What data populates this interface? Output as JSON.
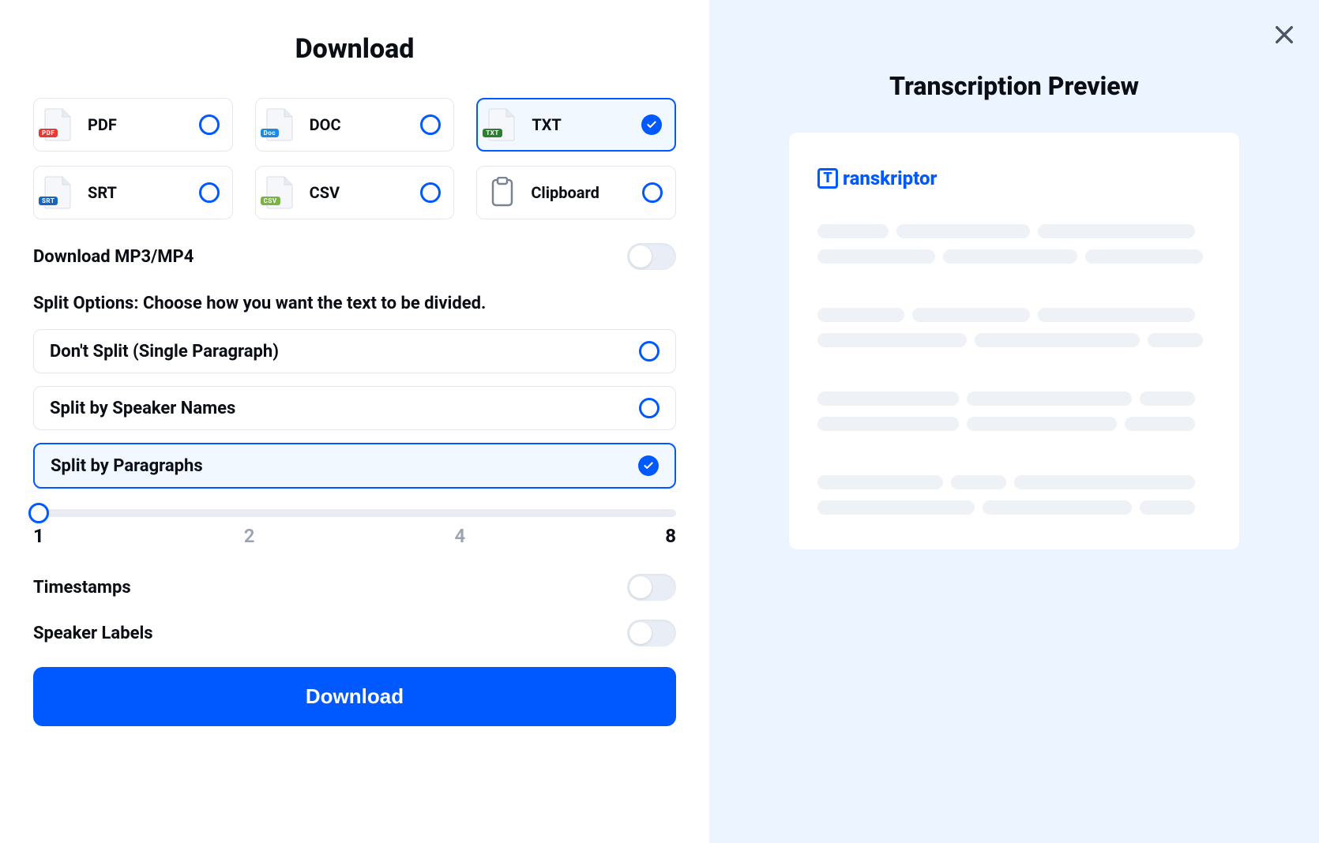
{
  "title": "Download",
  "formats": [
    {
      "label": "PDF",
      "badge": "PDF",
      "badge_color": "#e53935",
      "selected": false
    },
    {
      "label": "DOC",
      "badge": "Doc",
      "badge_color": "#1e88e5",
      "selected": false
    },
    {
      "label": "TXT",
      "badge": "TXT",
      "badge_color": "#2e7d32",
      "selected": true
    },
    {
      "label": "SRT",
      "badge": "SRT",
      "badge_color": "#1565c0",
      "selected": false
    },
    {
      "label": "CSV",
      "badge": "CSV",
      "badge_color": "#7cb342",
      "selected": false
    },
    {
      "label": "Clipboard",
      "clipboard": true,
      "selected": false
    }
  ],
  "download_media_label": "Download MP3/MP4",
  "download_media_on": false,
  "split_heading": "Split Options: Choose how you want the text to be divided.",
  "split_options": [
    {
      "label": "Don't Split (Single Paragraph)",
      "selected": false
    },
    {
      "label": "Split by Speaker Names",
      "selected": false
    },
    {
      "label": "Split by Paragraphs",
      "selected": true
    }
  ],
  "slider": {
    "value": 1,
    "ticks": [
      "1",
      "2",
      "4",
      "8"
    ]
  },
  "toggles": [
    {
      "label": "Timestamps",
      "on": false
    },
    {
      "label": "Speaker Labels",
      "on": false
    }
  ],
  "download_button": "Download",
  "preview_title": "Transcription Preview",
  "brand_name": "ranskriptor",
  "brand_initial": "T"
}
